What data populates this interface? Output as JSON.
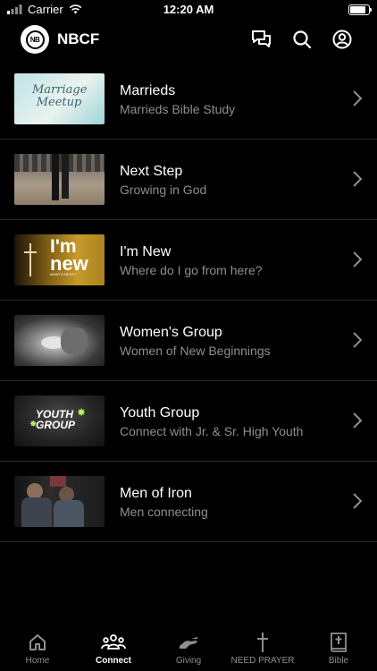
{
  "status": {
    "carrier": "Carrier",
    "time": "12:20 AM",
    "battery_level": 0.95
  },
  "header": {
    "brand": "NBCF",
    "logo_text": "NB",
    "icons": [
      "chat-icon",
      "search-icon",
      "profile-icon"
    ]
  },
  "items": [
    {
      "title": "Marrieds",
      "subtitle": "Marrieds Bible Study",
      "thumb_text": [
        "Marriage",
        "Meetup"
      ]
    },
    {
      "title": "Next Step",
      "subtitle": "Growing in God"
    },
    {
      "title": "I'm New",
      "subtitle": "Where do I go from here?",
      "thumb_text": [
        "I'm",
        "new",
        "WHAT'S NEXT?"
      ]
    },
    {
      "title": "Women's Group",
      "subtitle": "Women of New Beginnings"
    },
    {
      "title": "Youth Group",
      "subtitle": "Connect with Jr. & Sr. High Youth",
      "thumb_text": [
        "YOUTH",
        "GROUP"
      ]
    },
    {
      "title": "Men of Iron",
      "subtitle": "Men connecting"
    }
  ],
  "tabs": [
    {
      "label": "Home",
      "icon": "home-icon",
      "active": false
    },
    {
      "label": "Connect",
      "icon": "people-icon",
      "active": true
    },
    {
      "label": "Giving",
      "icon": "giving-hand-icon",
      "active": false
    },
    {
      "label": "NEED PRAYER",
      "icon": "cross-icon",
      "active": false
    },
    {
      "label": "Bible",
      "icon": "bible-icon",
      "active": false
    }
  ]
}
